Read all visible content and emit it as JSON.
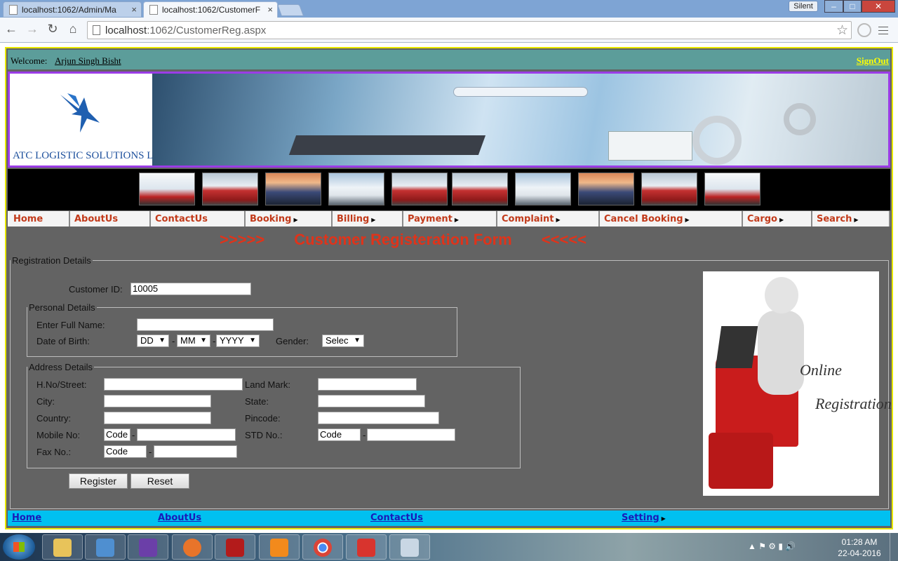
{
  "browser": {
    "tabs": [
      {
        "title": "localhost:1062/Admin/Ma"
      },
      {
        "title": "localhost:1062/CustomerF"
      }
    ],
    "tab_close": "×",
    "silent_label": "Silent",
    "url_host": "localhost",
    "url_rest": ":1062/CustomerReg.aspx"
  },
  "header": {
    "welcome_label": "Welcome:",
    "user_name": "Arjun Singh Bisht",
    "signout": "SignOut"
  },
  "logo": {
    "text": "ATC LOGISTIC SOLUTIONS LTD.,"
  },
  "thumbnails": [
    "plane",
    "red",
    "sunset",
    "white",
    "red",
    "red",
    "white",
    "sunset",
    "red",
    "plane"
  ],
  "menu": [
    {
      "label": "Home",
      "has_sub": false
    },
    {
      "label": "AboutUs",
      "has_sub": false
    },
    {
      "label": "ContactUs",
      "has_sub": false
    },
    {
      "label": "Booking",
      "has_sub": true
    },
    {
      "label": "Billing",
      "has_sub": true
    },
    {
      "label": "Payment",
      "has_sub": true
    },
    {
      "label": "Complaint",
      "has_sub": true
    },
    {
      "label": "Cancel Booking",
      "has_sub": true
    },
    {
      "label": "Cargo",
      "has_sub": true
    },
    {
      "label": "Search",
      "has_sub": true
    }
  ],
  "form": {
    "title_left": ">>>>>",
    "title": "Customer Registeration Form",
    "title_right": "<<<<<",
    "legend_registration": "Registration Details",
    "customer_id_label": "Customer ID:",
    "customer_id_value": "10005",
    "legend_personal": "Personal Details",
    "full_name_label": "Enter Full Name:",
    "full_name_value": "",
    "dob_label": "Date of Birth:",
    "dob_day": "DD",
    "dob_month": "MM",
    "dob_year": "YYYY",
    "gender_label": "Gender:",
    "gender_value": "Selec",
    "legend_address": "Address Details",
    "street_label": "H.No/Street:",
    "landmark_label": "Land Mark:",
    "city_label": "City:",
    "state_label": "State:",
    "country_label": "Country:",
    "pincode_label": "Pincode:",
    "mobile_label": "Mobile No:",
    "mobile_code": "Code",
    "std_label": "STD No.:",
    "std_code": "Code",
    "fax_label": "Fax No.:",
    "fax_code": "Code",
    "separator": "-",
    "register_button": "Register",
    "reset_button": "Reset"
  },
  "side_image": {
    "line1": "Online",
    "line2": "Registration"
  },
  "footer": {
    "home": "Home",
    "about": "AboutUs",
    "contact": "ContactUs",
    "setting": "Setting"
  },
  "taskbar": {
    "time": "01:28 AM",
    "date": "22-04-2016"
  },
  "colors": {
    "menu_text": "#c23a1a",
    "title_text": "#e0331a",
    "frame_border": "#e8e800",
    "banner_border": "#9b3ce6",
    "footer_bg": "#00c0f0",
    "welcome_bg": "#5c9d9a",
    "form_bg": "#636363"
  }
}
